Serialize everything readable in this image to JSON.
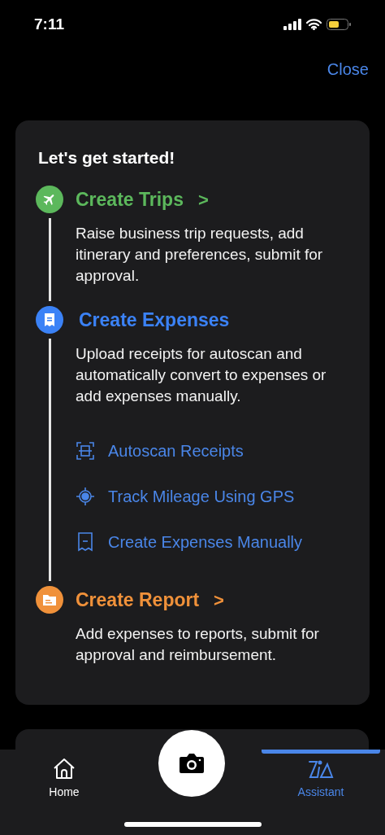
{
  "status_bar": {
    "time": "7:11"
  },
  "close": "Close",
  "card": {
    "title": "Let's get started!",
    "steps": [
      {
        "kind": "trip",
        "title": "Create Trips",
        "chevron": ">",
        "description": "Raise business trip requests, add itinerary and preferences, submit for approval.",
        "color": "#5cb85c"
      },
      {
        "kind": "expense",
        "title": "Create Expenses",
        "description": "Upload receipts for autoscan and automatically convert to expenses or add expenses manually.",
        "color": "#3b82f6",
        "actions": [
          {
            "kind": "scan",
            "label": "Autoscan Receipts"
          },
          {
            "kind": "gps",
            "label": "Track Mileage Using GPS"
          },
          {
            "kind": "receipt",
            "label": "Create Expenses Manually"
          }
        ]
      },
      {
        "kind": "report",
        "title": "Create Report",
        "chevron": ">",
        "description": "Add expenses to reports, submit for approval and reimbursement.",
        "color": "#f0913a"
      }
    ]
  },
  "tab_bar": {
    "tabs": [
      {
        "kind": "home",
        "label": "Home",
        "selected": false
      },
      {
        "kind": "camera"
      },
      {
        "kind": "assistant",
        "label": "Assistant",
        "selected": true
      }
    ]
  }
}
